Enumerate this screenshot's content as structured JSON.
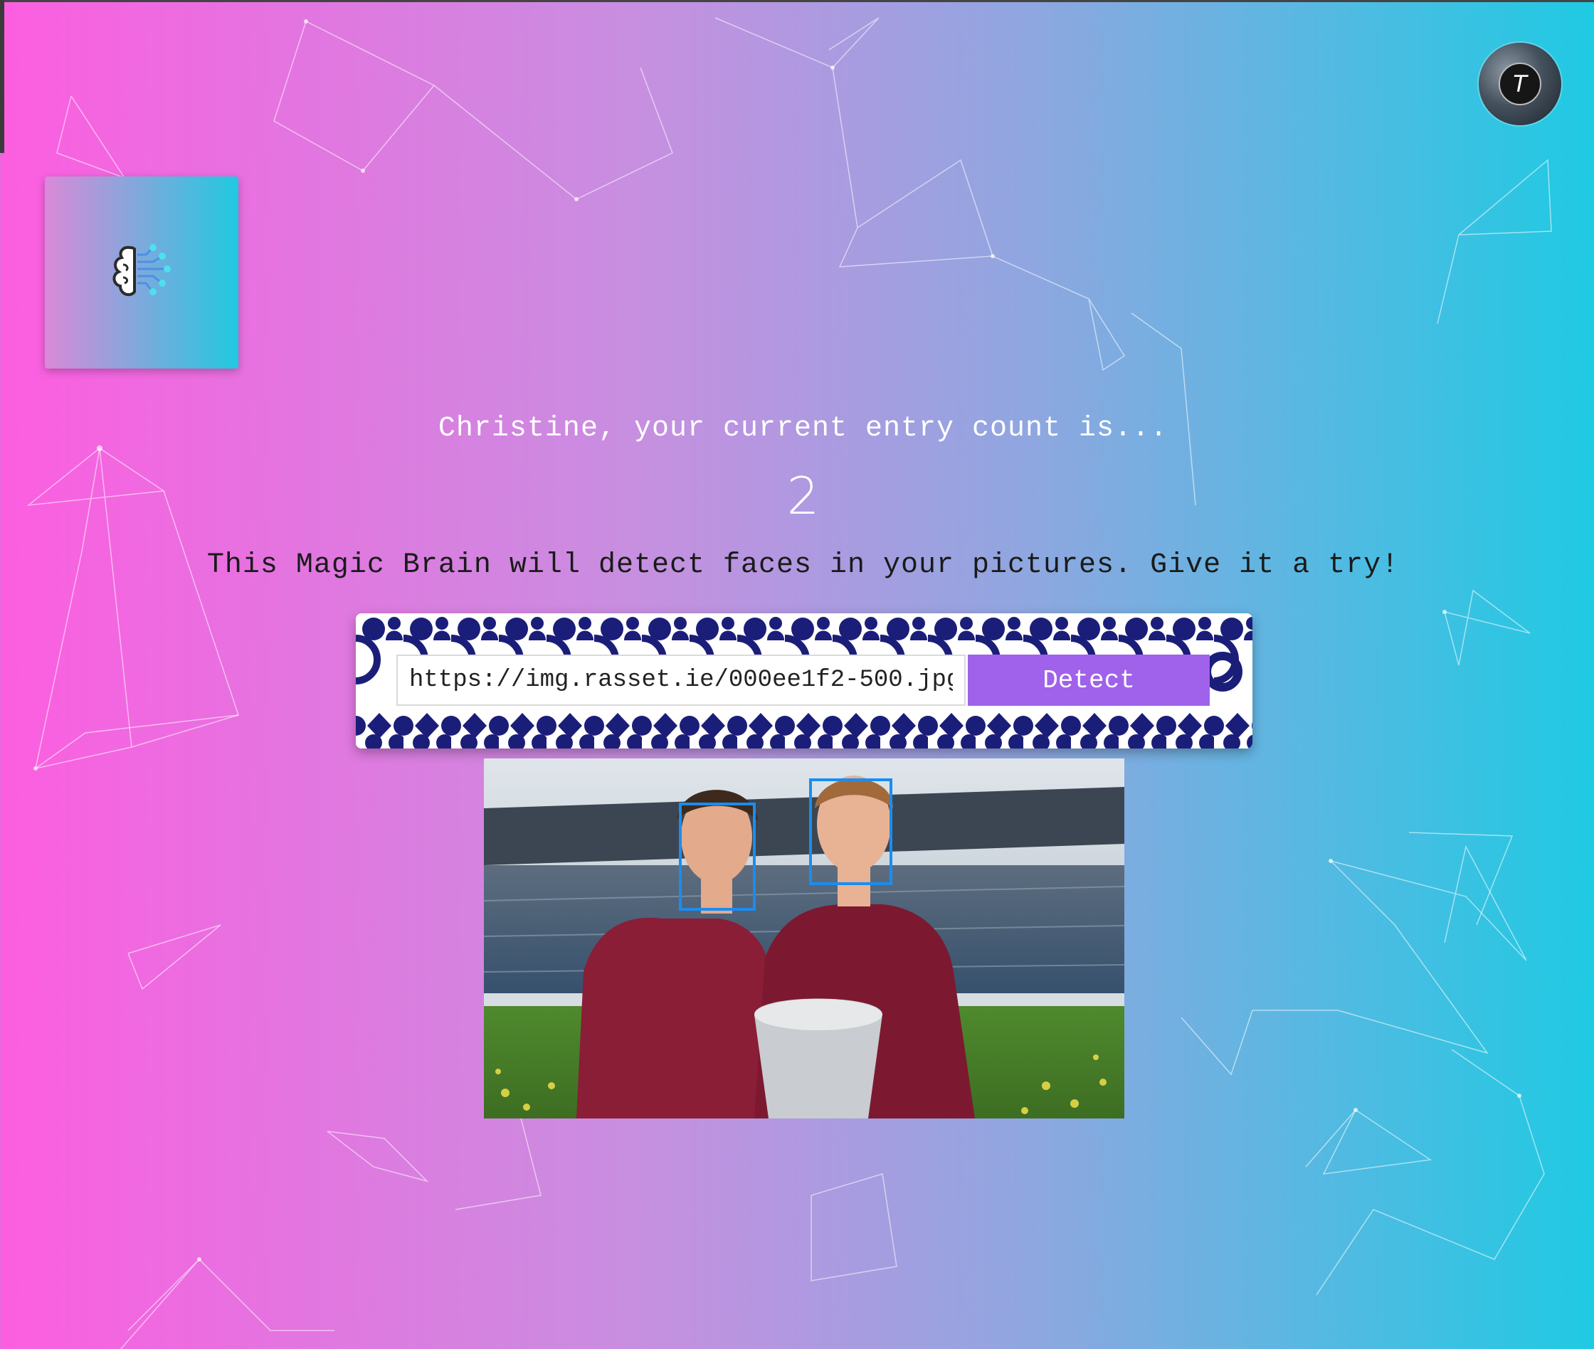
{
  "header": {
    "avatar_letter": "T"
  },
  "logo": {
    "icon": "brain-circuit-icon",
    "gradient_colors": [
      "#d98ad8",
      "#20c9e0"
    ]
  },
  "rank": {
    "greeting": "Christine, your current entry count is...",
    "count": "2"
  },
  "description": "This Magic Brain will detect faces in your pictures. Give it a try!",
  "form": {
    "url_value": "https://img.rasset.ie/000ee1f2-500.jpg",
    "button_label": "Detect"
  },
  "result": {
    "faces_detected": 2
  },
  "colors": {
    "background_gradient": [
      "#fc5ee0",
      "#1fcae3"
    ],
    "button": "#a061eb",
    "face_box": "#1a8df0",
    "pattern": "#1b1e78"
  }
}
